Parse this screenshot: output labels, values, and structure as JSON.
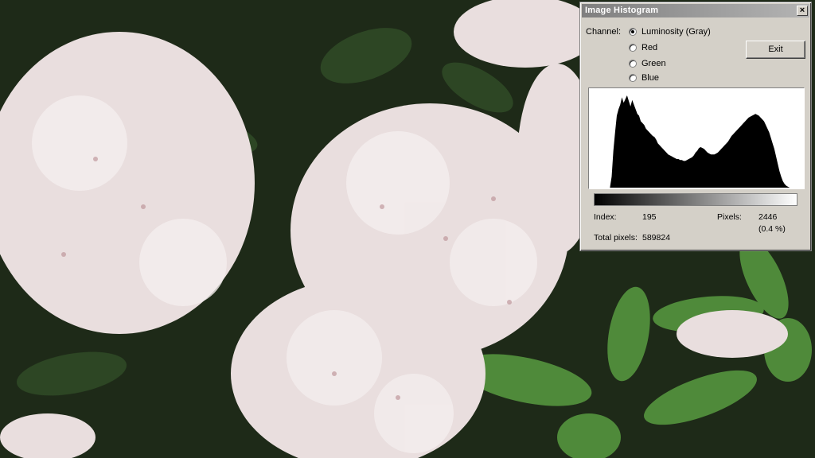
{
  "window": {
    "title": "Image Histogram",
    "close_glyph": "×",
    "close_icon": "close-icon"
  },
  "channel": {
    "label": "Channel:",
    "options": [
      {
        "label": "Luminosity (Gray)",
        "selected": true
      },
      {
        "label": "Red",
        "selected": false
      },
      {
        "label": "Green",
        "selected": false
      },
      {
        "label": "Blue",
        "selected": false
      }
    ]
  },
  "buttons": {
    "exit": "Exit"
  },
  "histogram": {
    "levels": [
      0,
      0,
      0,
      0,
      0,
      0,
      0,
      0,
      0,
      0,
      12,
      40,
      60,
      78,
      85,
      90,
      98,
      92,
      96,
      100,
      94,
      88,
      95,
      90,
      85,
      80,
      78,
      72,
      70,
      68,
      64,
      62,
      60,
      58,
      56,
      55,
      52,
      48,
      46,
      44,
      42,
      40,
      38,
      36,
      35,
      34,
      33,
      32,
      31,
      31,
      30,
      30,
      29,
      29,
      30,
      31,
      32,
      33,
      35,
      38,
      40,
      43,
      44,
      43,
      42,
      40,
      38,
      37,
      36,
      36,
      36,
      37,
      38,
      40,
      42,
      44,
      46,
      48,
      50,
      53,
      56,
      58,
      60,
      62,
      64,
      66,
      68,
      70,
      72,
      74,
      76,
      77,
      78,
      79,
      80,
      79,
      78,
      76,
      74,
      72,
      68,
      64,
      60,
      54,
      48,
      42,
      34,
      26,
      18,
      12,
      7,
      4,
      2,
      1,
      0,
      0,
      0,
      0,
      0,
      0
    ]
  },
  "stats": {
    "index_label": "Index:",
    "index_value": "195",
    "pixels_label": "Pixels:",
    "pixels_value": "2446",
    "pixels_percent": "(0.4 %)",
    "total_label": "Total pixels:",
    "total_value": "589824"
  }
}
